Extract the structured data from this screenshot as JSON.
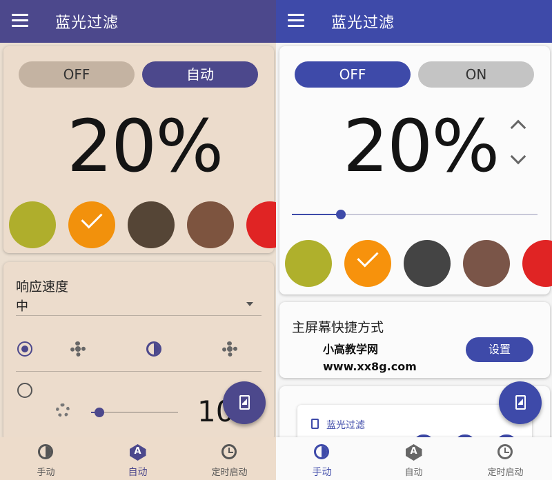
{
  "left": {
    "appbar": {
      "title": "蓝光过滤"
    },
    "toggle": {
      "off_label": "OFF",
      "on_label": "自动"
    },
    "percentage": "20%",
    "swatches": [
      {
        "name": "olive",
        "color": "#afae2c"
      },
      {
        "name": "orange",
        "color": "#f2910c",
        "selected": true
      },
      {
        "name": "dark-brown",
        "color": "#554536"
      },
      {
        "name": "brown",
        "color": "#7d543f"
      },
      {
        "name": "red",
        "color": "#e02424"
      }
    ],
    "response": {
      "title": "响应速度",
      "value": "中"
    },
    "slider": {
      "value_label": "10"
    },
    "nav": {
      "manual": "手动",
      "auto": "自动",
      "scheduled": "定时启动"
    },
    "colors": {
      "accent": "#4c488c",
      "background": "#ebdfd1"
    }
  },
  "right": {
    "appbar": {
      "title": "蓝光过滤"
    },
    "toggle": {
      "off_label": "OFF",
      "on_label": "ON"
    },
    "percentage": "20%",
    "slider": {
      "level": 0.2
    },
    "swatches": [
      {
        "name": "olive",
        "color": "#afb02c"
      },
      {
        "name": "orange",
        "color": "#f7920c",
        "selected": true
      },
      {
        "name": "dark-gray",
        "color": "#444444"
      },
      {
        "name": "brown",
        "color": "#7a5548"
      },
      {
        "name": "red",
        "color": "#e02424"
      }
    ],
    "shortcut": {
      "title": "主屏幕快捷方式",
      "button": "设置"
    },
    "watermark": {
      "line1": "小高教学网",
      "line2": "www.xx8g.com"
    },
    "widget": {
      "title": "蓝光过滤"
    },
    "nav": {
      "manual": "手动",
      "auto": "自动",
      "scheduled": "定时启动"
    },
    "colors": {
      "accent": "#3e4aa9",
      "background": "#f4f4f4"
    }
  }
}
